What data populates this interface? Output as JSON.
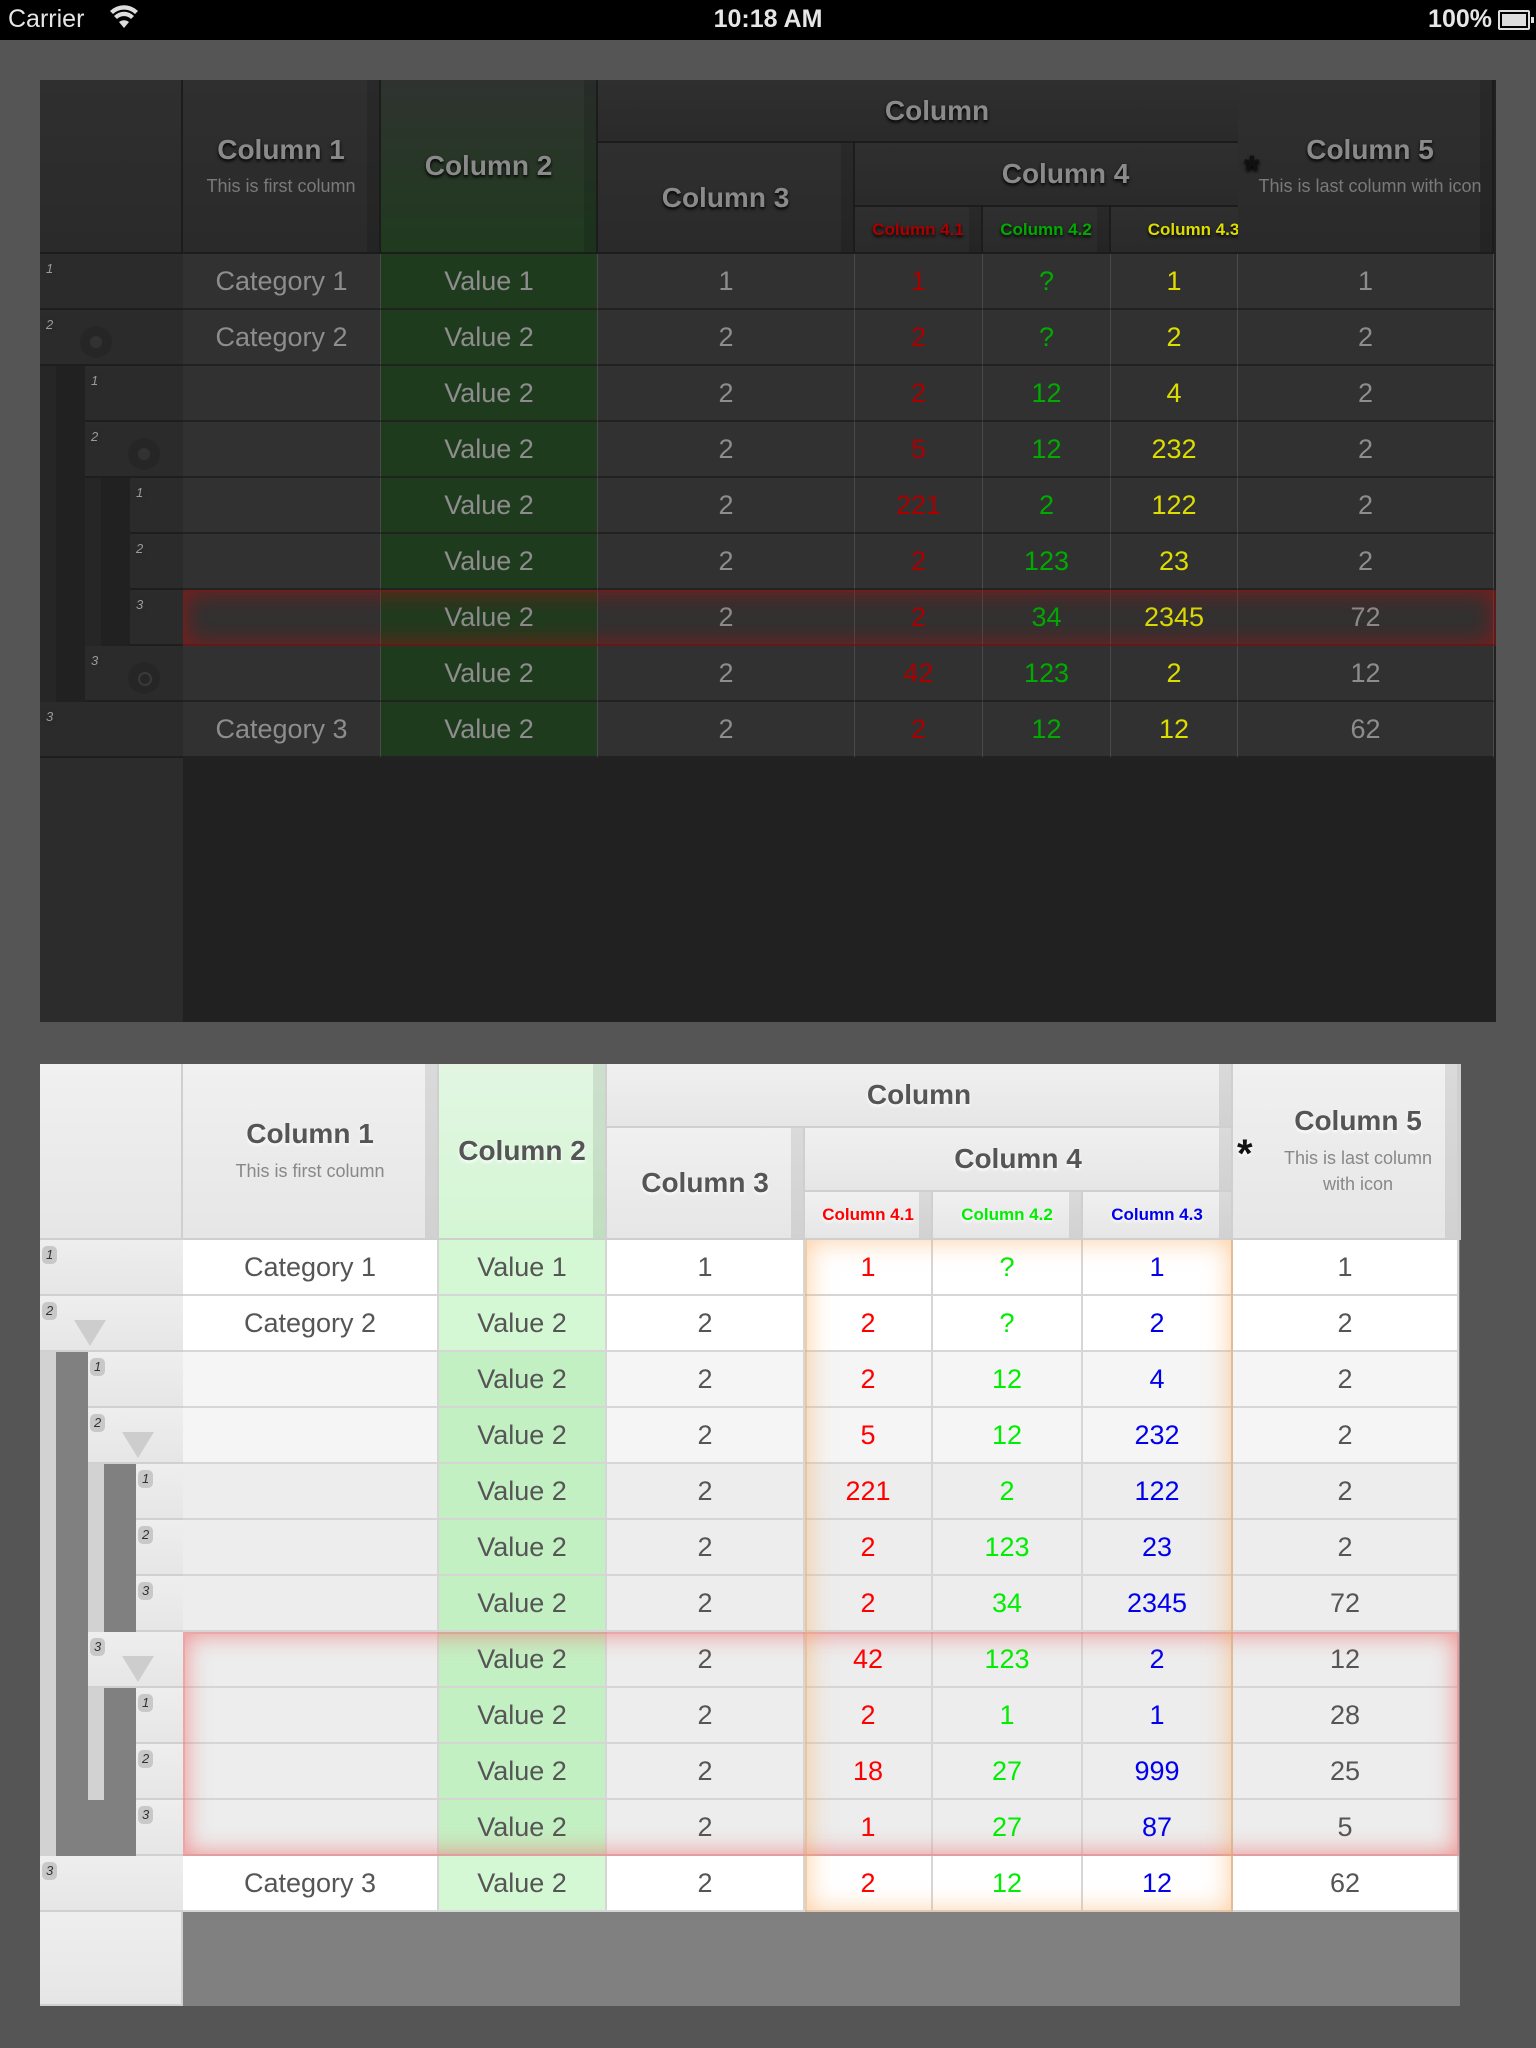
{
  "status_bar": {
    "carrier": "Carrier",
    "time": "10:18 AM",
    "battery": "100%"
  },
  "colors": {
    "dark_col41": "#aa0000",
    "dark_col42": "#00aa00",
    "dark_col43": "#dddd00",
    "light_col41": "#ff0000",
    "light_col42": "#00ee00",
    "light_col43": "#0000ee"
  },
  "headers": {
    "group": "Column",
    "col1": "Column 1",
    "col1_sub": "This is first column",
    "col2": "Column 2",
    "col3": "Column 3",
    "col4": "Column 4",
    "col41": "Column 4.1",
    "col42": "Column 4.2",
    "col43": "Column 4.3",
    "col5": "Column 5",
    "col5_sub": "This is last column with icon",
    "col5_icon": "asterisk-icon"
  },
  "dark_table": {
    "rows": [
      {
        "level": 0,
        "num": "1",
        "col1": "Category 1",
        "col2": "Value 1",
        "col3": "1",
        "c41": "1",
        "c42": "?",
        "c43": "1",
        "col5": "1"
      },
      {
        "level": 0,
        "num": "2",
        "col1": "Category 2",
        "col2": "Value 2",
        "col3": "2",
        "c41": "2",
        "c42": "?",
        "c43": "2",
        "col5": "2"
      },
      {
        "level": 1,
        "num": "1",
        "col1": "",
        "col2": "Value 2",
        "col3": "2",
        "c41": "2",
        "c42": "12",
        "c43": "4",
        "col5": "2"
      },
      {
        "level": 1,
        "num": "2",
        "col1": "",
        "col2": "Value 2",
        "col3": "2",
        "c41": "5",
        "c42": "12",
        "c43": "232",
        "col5": "2"
      },
      {
        "level": 2,
        "num": "1",
        "col1": "",
        "col2": "Value 2",
        "col3": "2",
        "c41": "221",
        "c42": "2",
        "c43": "122",
        "col5": "2"
      },
      {
        "level": 2,
        "num": "2",
        "col1": "",
        "col2": "Value 2",
        "col3": "2",
        "c41": "2",
        "c42": "123",
        "c43": "23",
        "col5": "2"
      },
      {
        "level": 2,
        "num": "3",
        "col1": "",
        "col2": "Value 2",
        "col3": "2",
        "c41": "2",
        "c42": "34",
        "c43": "2345",
        "col5": "72",
        "selected": true
      },
      {
        "level": 1,
        "num": "3",
        "col1": "",
        "col2": "Value 2",
        "col3": "2",
        "c41": "42",
        "c42": "123",
        "c43": "2",
        "col5": "12"
      },
      {
        "level": 0,
        "num": "3",
        "col1": "Category 3",
        "col2": "Value 2",
        "col3": "2",
        "c41": "2",
        "c42": "12",
        "c43": "12",
        "col5": "62"
      }
    ]
  },
  "light_table": {
    "rows": [
      {
        "level": 0,
        "num": "1",
        "col1": "Category 1",
        "col2": "Value 1",
        "col3": "1",
        "c41": "1",
        "c42": "?",
        "c43": "1",
        "col5": "1"
      },
      {
        "level": 0,
        "num": "2",
        "col1": "Category 2",
        "col2": "Value 2",
        "col3": "2",
        "c41": "2",
        "c42": "?",
        "c43": "2",
        "col5": "2"
      },
      {
        "level": 1,
        "num": "1",
        "col1": "",
        "col2": "Value 2",
        "col3": "2",
        "c41": "2",
        "c42": "12",
        "c43": "4",
        "col5": "2"
      },
      {
        "level": 1,
        "num": "2",
        "col1": "",
        "col2": "Value 2",
        "col3": "2",
        "c41": "5",
        "c42": "12",
        "c43": "232",
        "col5": "2"
      },
      {
        "level": 2,
        "num": "1",
        "col1": "",
        "col2": "Value 2",
        "col3": "2",
        "c41": "221",
        "c42": "2",
        "c43": "122",
        "col5": "2"
      },
      {
        "level": 2,
        "num": "2",
        "col1": "",
        "col2": "Value 2",
        "col3": "2",
        "c41": "2",
        "c42": "123",
        "c43": "23",
        "col5": "2"
      },
      {
        "level": 2,
        "num": "3",
        "col1": "",
        "col2": "Value 2",
        "col3": "2",
        "c41": "2",
        "c42": "34",
        "c43": "2345",
        "col5": "72"
      },
      {
        "level": 1,
        "num": "3",
        "col1": "",
        "col2": "Value 2",
        "col3": "2",
        "c41": "42",
        "c42": "123",
        "c43": "2",
        "col5": "12",
        "selected": true
      },
      {
        "level": 2,
        "num": "1",
        "col1": "",
        "col2": "Value 2",
        "col3": "2",
        "c41": "2",
        "c42": "1",
        "c43": "1",
        "col5": "28",
        "selected": true
      },
      {
        "level": 2,
        "num": "2",
        "col1": "",
        "col2": "Value 2",
        "col3": "2",
        "c41": "18",
        "c42": "27",
        "c43": "999",
        "col5": "25",
        "selected": true
      },
      {
        "level": 2,
        "num": "3",
        "col1": "",
        "col2": "Value 2",
        "col3": "2",
        "c41": "1",
        "c42": "27",
        "c43": "87",
        "col5": "5",
        "selected": true
      },
      {
        "level": 0,
        "num": "3",
        "col1": "Category 3",
        "col2": "Value 2",
        "col3": "2",
        "c41": "2",
        "c42": "12",
        "c43": "12",
        "col5": "62"
      }
    ]
  }
}
